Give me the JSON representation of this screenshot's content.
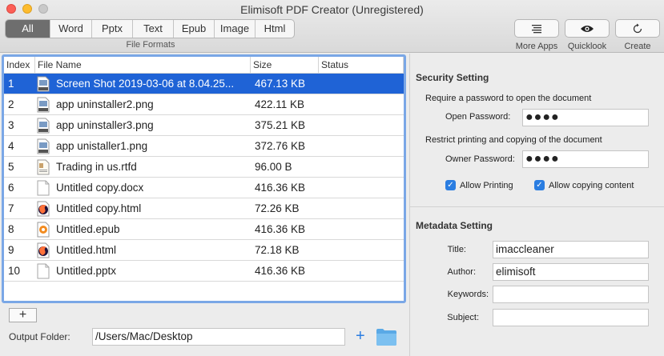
{
  "window": {
    "title": "Elimisoft PDF Creator (Unregistered)"
  },
  "formats": {
    "tabs": [
      "All",
      "Word",
      "Pptx",
      "Text",
      "Epub",
      "Image",
      "Html"
    ],
    "active": "All",
    "caption": "File Formats"
  },
  "tools": {
    "more_apps": "More Apps",
    "quicklook": "Quicklook",
    "create": "Create"
  },
  "table": {
    "headers": {
      "index": "Index",
      "name": "File Name",
      "size": "Size",
      "status": "Status"
    },
    "rows": [
      {
        "index": "1",
        "name": "Screen Shot 2019-03-06 at 8.04.25...",
        "size": "467.13 KB",
        "status": "",
        "icon": "png-file-icon",
        "selected": true
      },
      {
        "index": "2",
        "name": "app uninstaller2.png",
        "size": "422.11 KB",
        "status": "",
        "icon": "png-file-icon"
      },
      {
        "index": "3",
        "name": "app uninstaller3.png",
        "size": "375.21 KB",
        "status": "",
        "icon": "png-file-icon"
      },
      {
        "index": "4",
        "name": "app unistaller1.png",
        "size": "372.76 KB",
        "status": "",
        "icon": "png-file-icon"
      },
      {
        "index": "5",
        "name": "Trading in us.rtfd",
        "size": "96.00 B",
        "status": "",
        "icon": "rtfd-file-icon"
      },
      {
        "index": "6",
        "name": "Untitled copy.docx",
        "size": "416.36 KB",
        "status": "",
        "icon": "blank-file-icon"
      },
      {
        "index": "7",
        "name": "Untitled copy.html",
        "size": "72.26 KB",
        "status": "",
        "icon": "firefox-html-icon"
      },
      {
        "index": "8",
        "name": "Untitled.epub",
        "size": "416.36 KB",
        "status": "",
        "icon": "epub-file-icon"
      },
      {
        "index": "9",
        "name": "Untitled.html",
        "size": "72.18 KB",
        "status": "",
        "icon": "firefox-html-icon"
      },
      {
        "index": "10",
        "name": "Untitled.pptx",
        "size": "416.36 KB",
        "status": "",
        "icon": "blank-file-icon"
      }
    ]
  },
  "add_button": "+",
  "output": {
    "label": "Output Folder:",
    "path": "/Users/Mac/Desktop",
    "plus": "+"
  },
  "security": {
    "title": "Security Setting",
    "open_desc": "Require a password to open the document",
    "open_label": "Open Password:",
    "open_value": "●●●●",
    "restrict_desc": "Restrict printing and copying of the document",
    "owner_label": "Owner Password:",
    "owner_value": "●●●●",
    "allow_printing": "Allow Printing",
    "allow_copying": "Allow copying content",
    "allow_printing_checked": true,
    "allow_copying_checked": true
  },
  "metadata": {
    "title": "Metadata Setting",
    "title_label": "Title:",
    "title_value": "imaccleaner",
    "author_label": "Author:",
    "author_value": "elimisoft",
    "keywords_label": "Keywords:",
    "keywords_value": "",
    "subject_label": "Subject:",
    "subject_value": ""
  },
  "colors": {
    "selection": "#1f63d6",
    "accent": "#2a7de1"
  }
}
